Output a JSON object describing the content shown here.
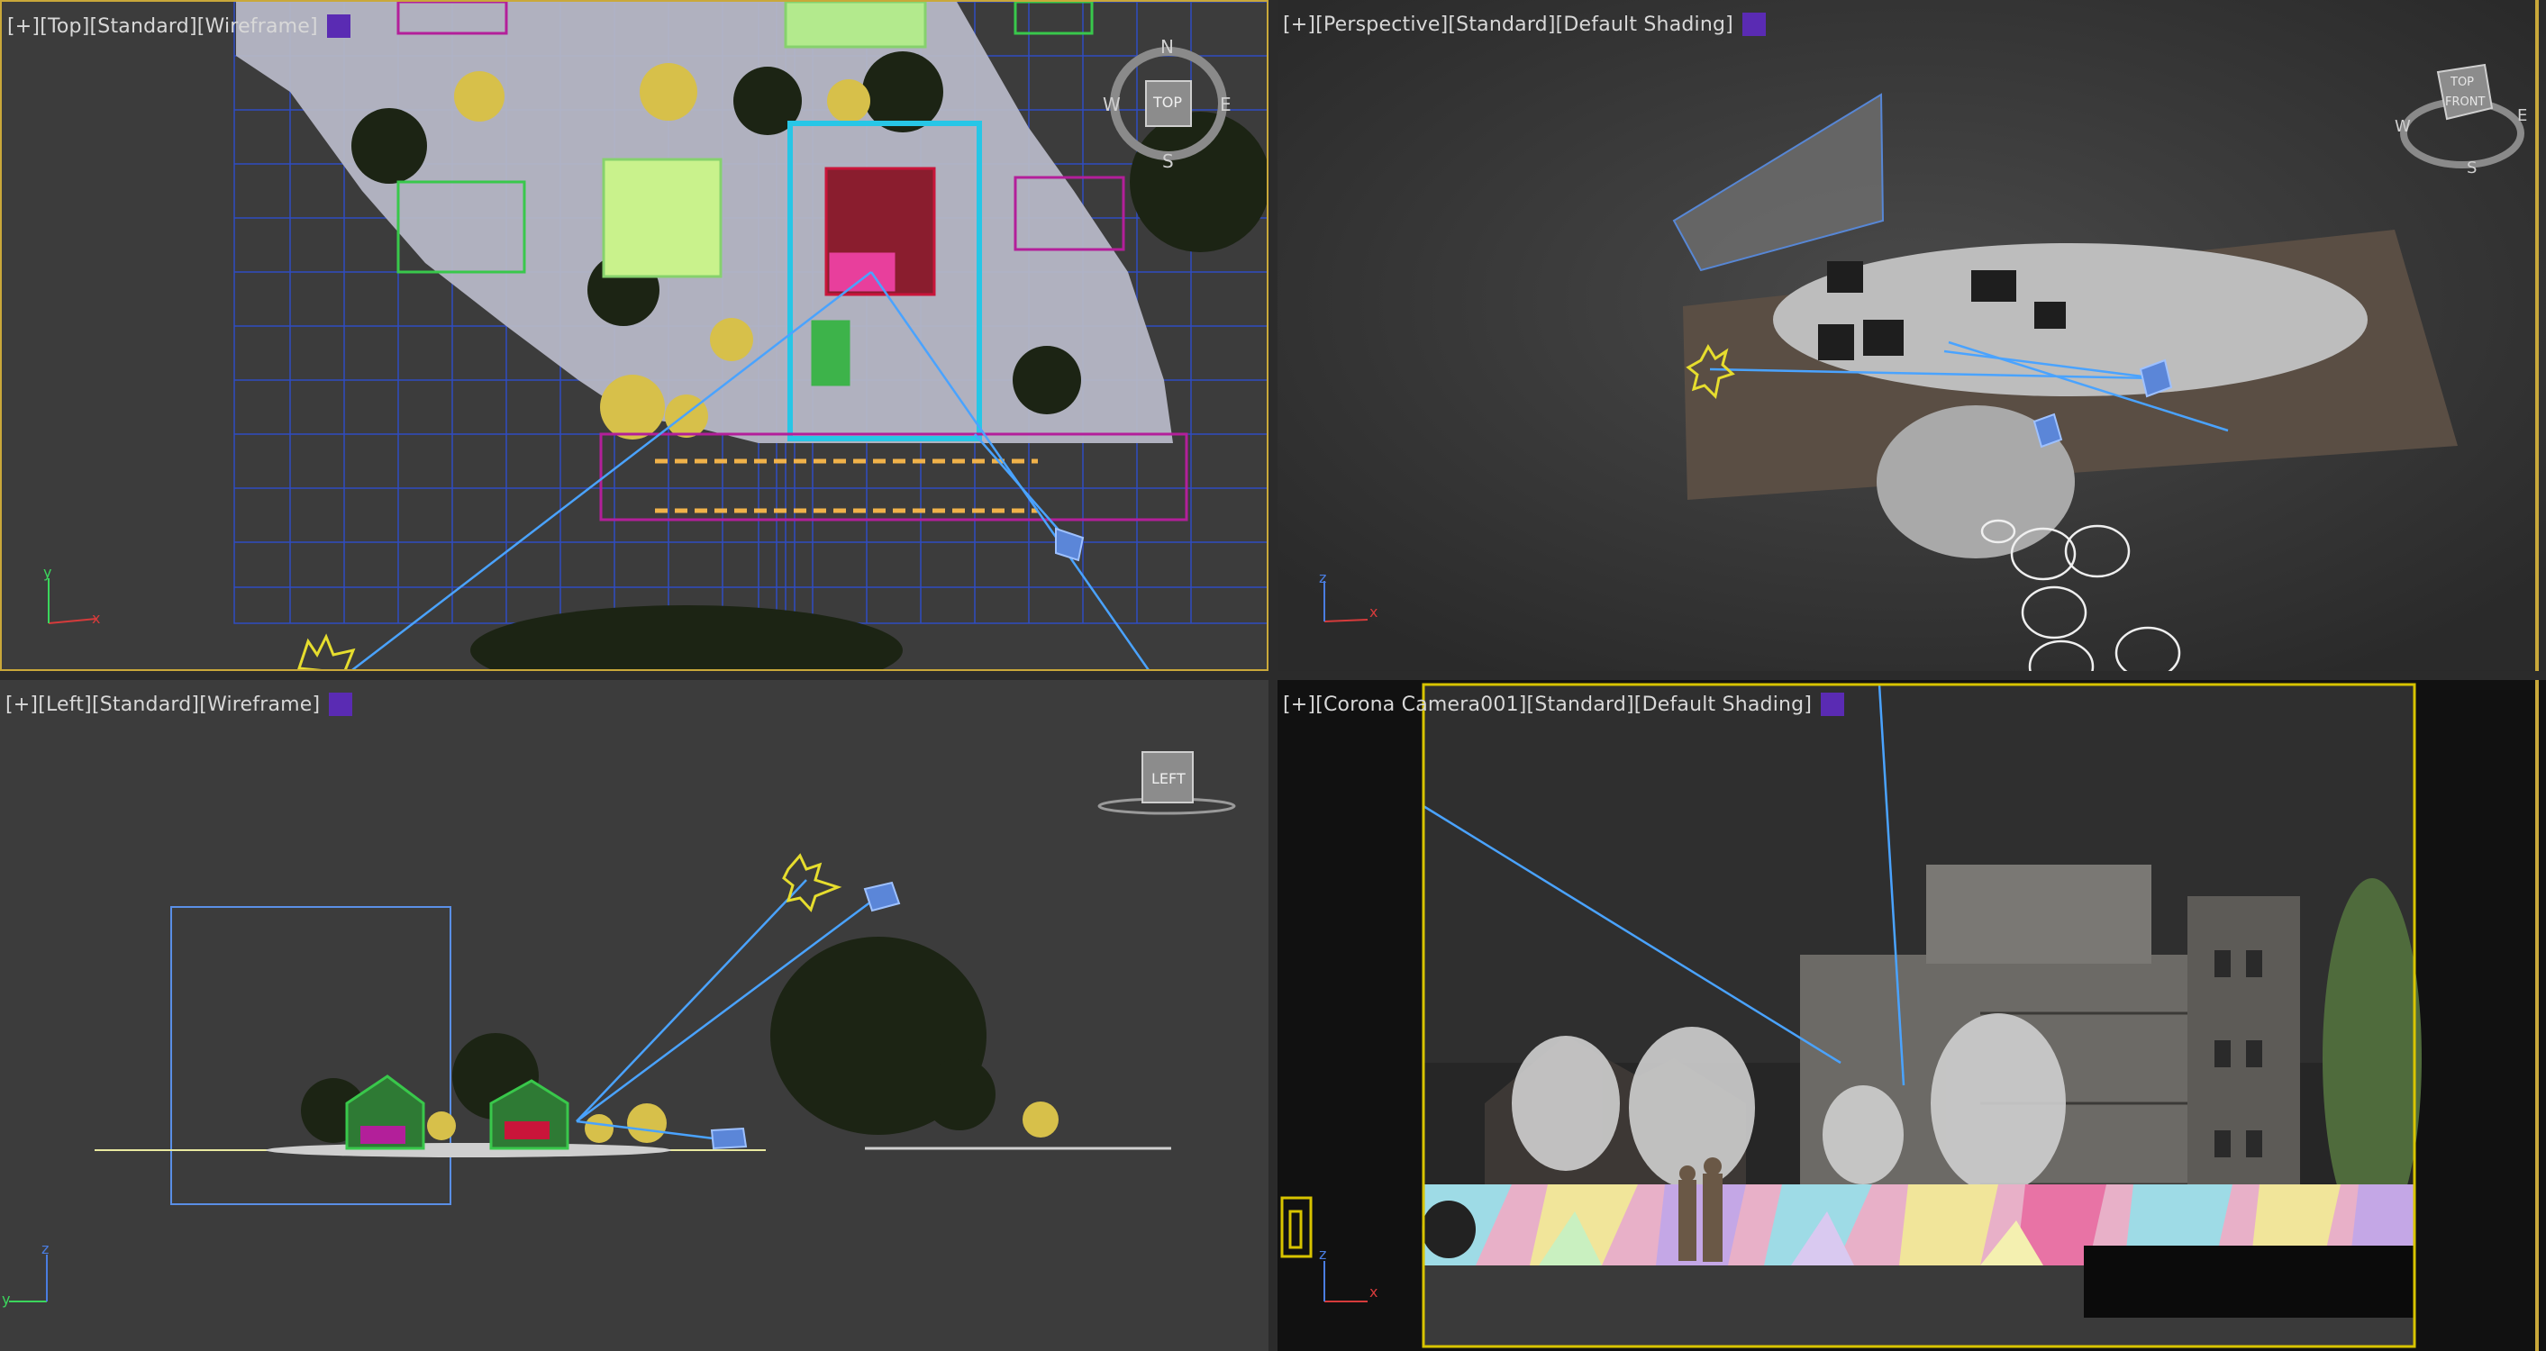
{
  "colors": {
    "background": "#3c3c3c",
    "active_border": "#c9a83a",
    "label_text": "#d8d8d8",
    "swatch": "#5a2bb3",
    "camera_line": "#4aa3ff",
    "camera_frame": "#d8c400"
  },
  "viewports": {
    "top": {
      "label": "[+][Top][Standard][Wireframe]",
      "swatch_icon": "display-swatch",
      "nav_letters": {
        "n": "N",
        "e": "E",
        "s": "S",
        "w": "W",
        "cube": "TOP"
      },
      "axis": {
        "x": "x",
        "y": "y"
      }
    },
    "perspective": {
      "label": "[+][Perspective][Standard][Default Shading]",
      "swatch_icon": "display-swatch",
      "nav_letters": {
        "s": "S",
        "w": "W",
        "e": "E",
        "cube_top": "TOP",
        "cube_front": "FRONT"
      },
      "axis": {
        "x": "x",
        "z": "z"
      }
    },
    "left": {
      "label": "[+][Left][Standard][Wireframe]",
      "swatch_icon": "display-swatch",
      "nav_letters": {
        "cube": "LEFT"
      },
      "axis": {
        "y": "y",
        "z": "z"
      }
    },
    "camera": {
      "label": "[+][Corona Camera001][Standard][Default Shading]",
      "swatch_icon": "display-swatch",
      "axis": {
        "x": "x",
        "z": "z"
      }
    }
  }
}
